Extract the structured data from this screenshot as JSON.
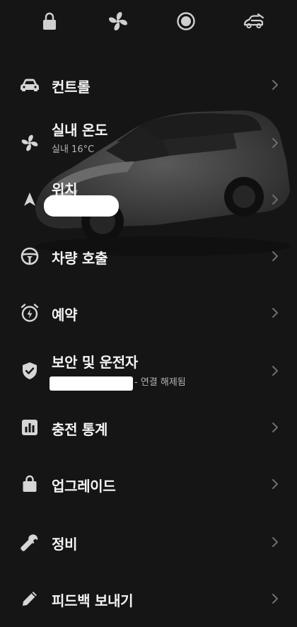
{
  "top_icons": [
    {
      "name": "lock-icon"
    },
    {
      "name": "fan-icon"
    },
    {
      "name": "record-icon"
    },
    {
      "name": "car-frunk-icon"
    }
  ],
  "menu": {
    "items": [
      {
        "label": "컨트롤",
        "icon": "car-icon"
      },
      {
        "label": "실내 온도",
        "sub": "실내 16°C",
        "icon": "fan-icon"
      },
      {
        "label": "위치",
        "icon": "navigation-arrow-icon",
        "sub_redacted": true
      },
      {
        "label": "차량 호출",
        "icon": "steering-wheel-icon"
      },
      {
        "label": "예약",
        "icon": "alarm-clock-icon"
      },
      {
        "label": "보안 및 운전자",
        "sub": "- 연결 해제됨",
        "icon": "shield-check-icon",
        "sub_redacted": true
      },
      {
        "label": "충전 통계",
        "icon": "bar-chart-icon"
      },
      {
        "label": "업그레이드",
        "icon": "shopping-bag-icon"
      },
      {
        "label": "정비",
        "icon": "wrench-icon"
      },
      {
        "label": "피드백 보내기",
        "icon": "pencil-icon"
      }
    ]
  },
  "colors": {
    "background": "#151515",
    "text": "#f4f4f4",
    "subtext": "#b4b4b4",
    "icon": "#d6d6d6",
    "chevron": "#6e6e6e"
  }
}
